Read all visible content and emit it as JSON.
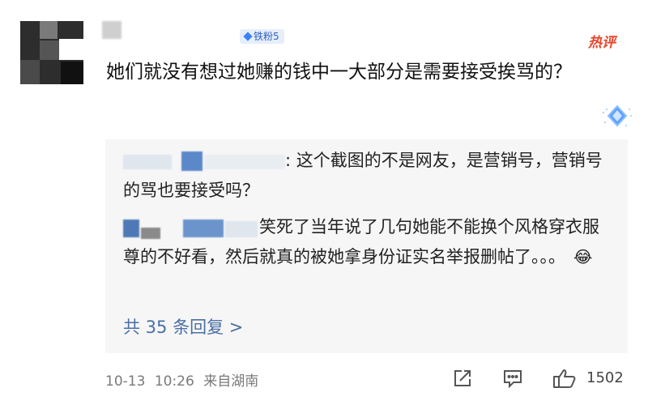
{
  "comment": {
    "fan_badge": "铁粉5",
    "hot_tag": "热评",
    "text": "她们就没有想过她赚的钱中一大部分是需要接受挨骂的？"
  },
  "replies": [
    {
      "text": ": 这个截图的不是网友，是营销号，营销号的骂也要接受吗？"
    },
    {
      "text": "笑死了当年说了几句她能不能换个风格穿衣服尊的不好看，然后就真的被她拿身份证实名举报删帖了。。。"
    }
  ],
  "reply_emoji": "😂",
  "more_replies": "共 35 条回复 >",
  "footer": {
    "date": "10-13",
    "time": "10:26",
    "location": "来自湖南",
    "like_count": "1502"
  },
  "colors": {
    "hot": "#e8452c",
    "link": "#4a6fa5",
    "badge": "#2f5fbf"
  },
  "icons": [
    "share-icon",
    "comment-icon",
    "like-icon",
    "gem-icon",
    "fan-diamond-icon"
  ]
}
